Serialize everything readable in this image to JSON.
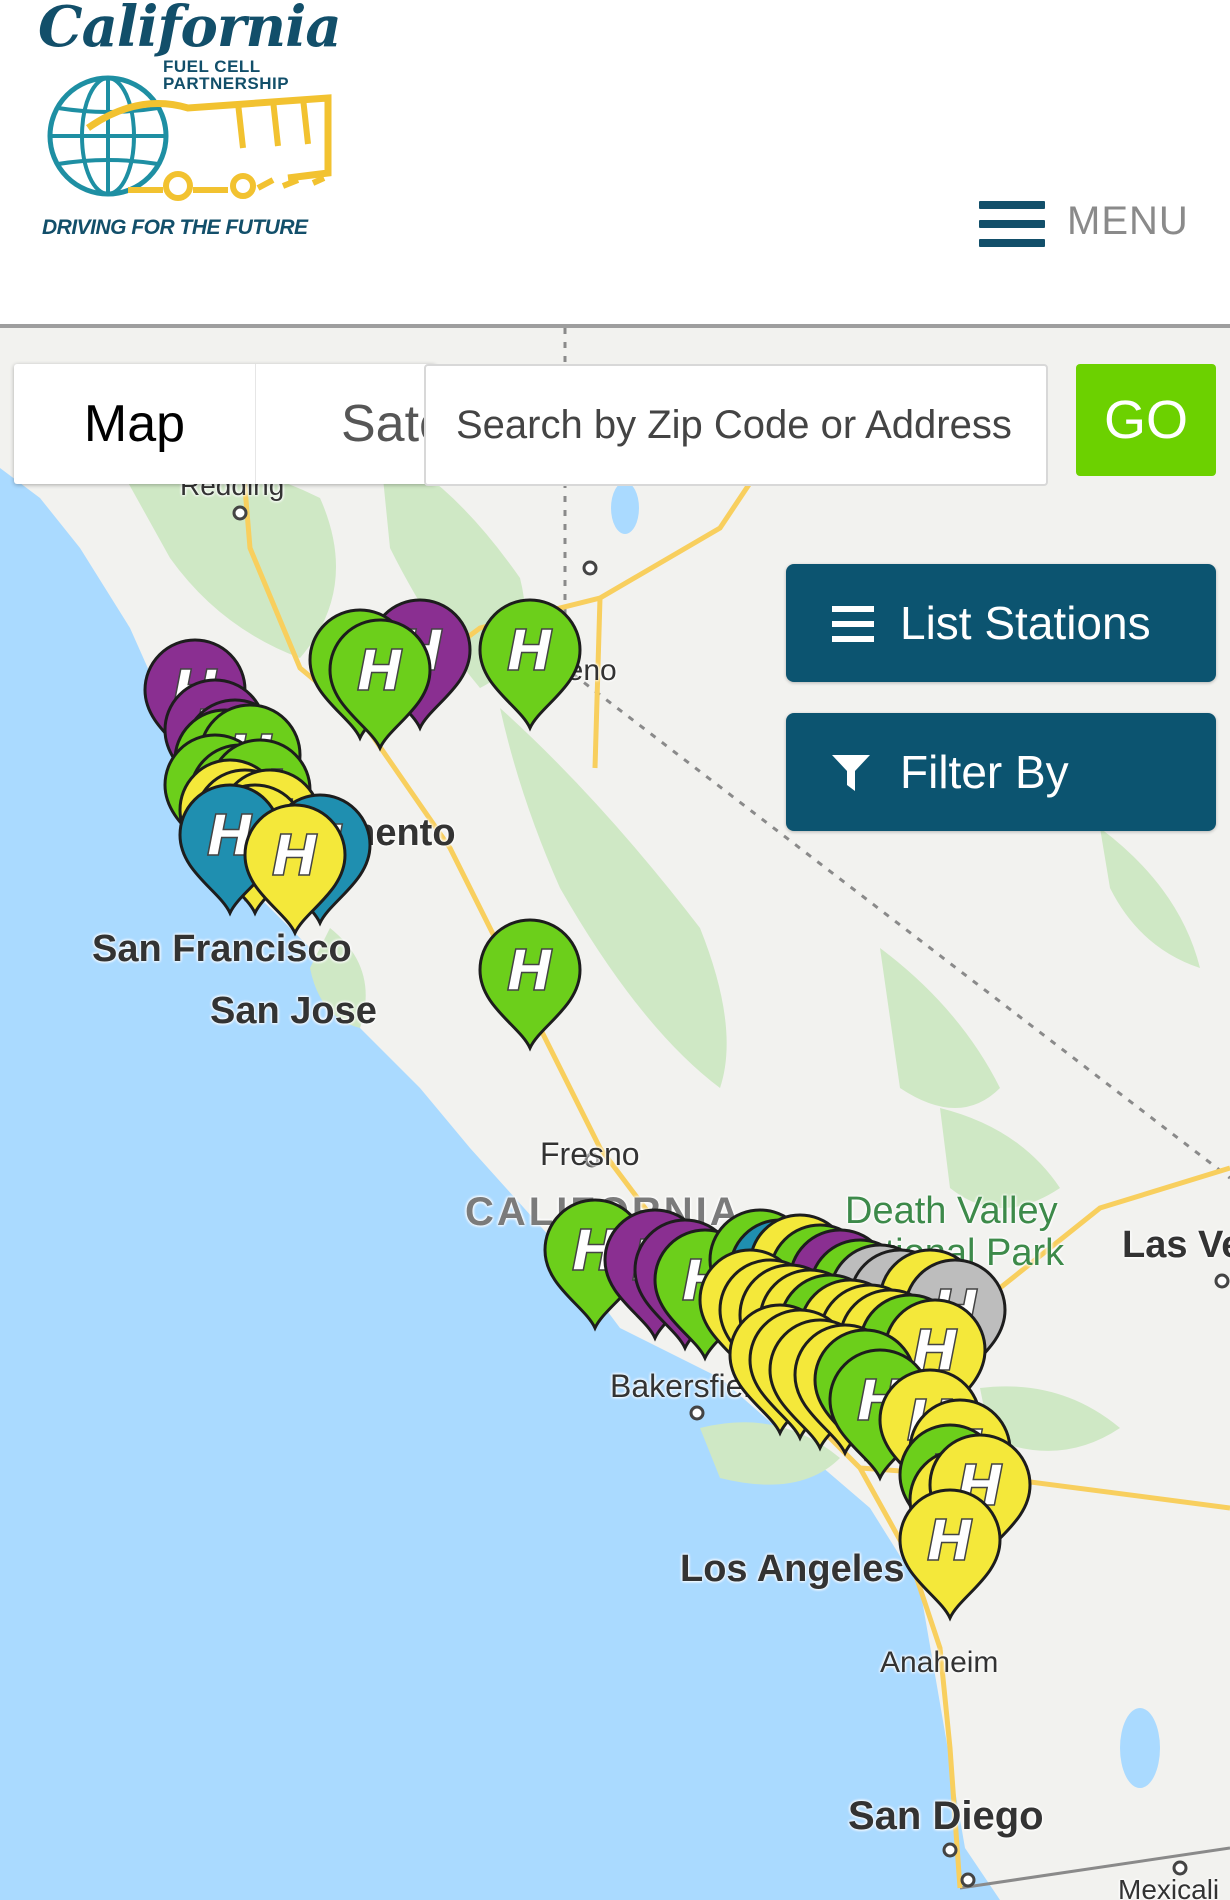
{
  "header": {
    "logo": {
      "title": "California",
      "subtitle_line1": "FUEL CELL",
      "subtitle_line2": "PARTNERSHIP",
      "tagline": "DRIVING FOR THE FUTURE"
    },
    "menu_label": "MENU"
  },
  "map": {
    "map_type": {
      "map_label": "Map",
      "satellite_label": "Satellite"
    },
    "search": {
      "placeholder": "Search by Zip Code or Address",
      "value": ""
    },
    "go_label": "GO",
    "list_stations_label": "List Stations",
    "filter_by_label": "Filter By",
    "places": {
      "redding": "Redding",
      "reno": "Reno",
      "sacramento": "Sacramento",
      "san_francisco": "San Francisco",
      "san_jose": "San Jose",
      "fresno": "Fresno",
      "california": "CALIFORNIA",
      "death_valley_1": "Death Valley",
      "death_valley_2": "National Park",
      "las_vegas": "Las Vegas",
      "bakersfield": "Bakersfield",
      "los_angeles": "Los Angeles",
      "anaheim": "Anaheim",
      "san_diego": "San Diego",
      "mexicali": "Mexicali"
    },
    "marker_letter": "H",
    "marker_colors": {
      "green": "#6ccf1b",
      "purple": "#8a2f91",
      "yellow": "#f4e83a",
      "teal": "#1f8fb0",
      "gray": "#bdbdbd"
    },
    "colors": {
      "water": "#aadaff",
      "land": "#f2f2ef",
      "parks": "#cfe8c5",
      "roads": "#f8cf5e"
    }
  }
}
